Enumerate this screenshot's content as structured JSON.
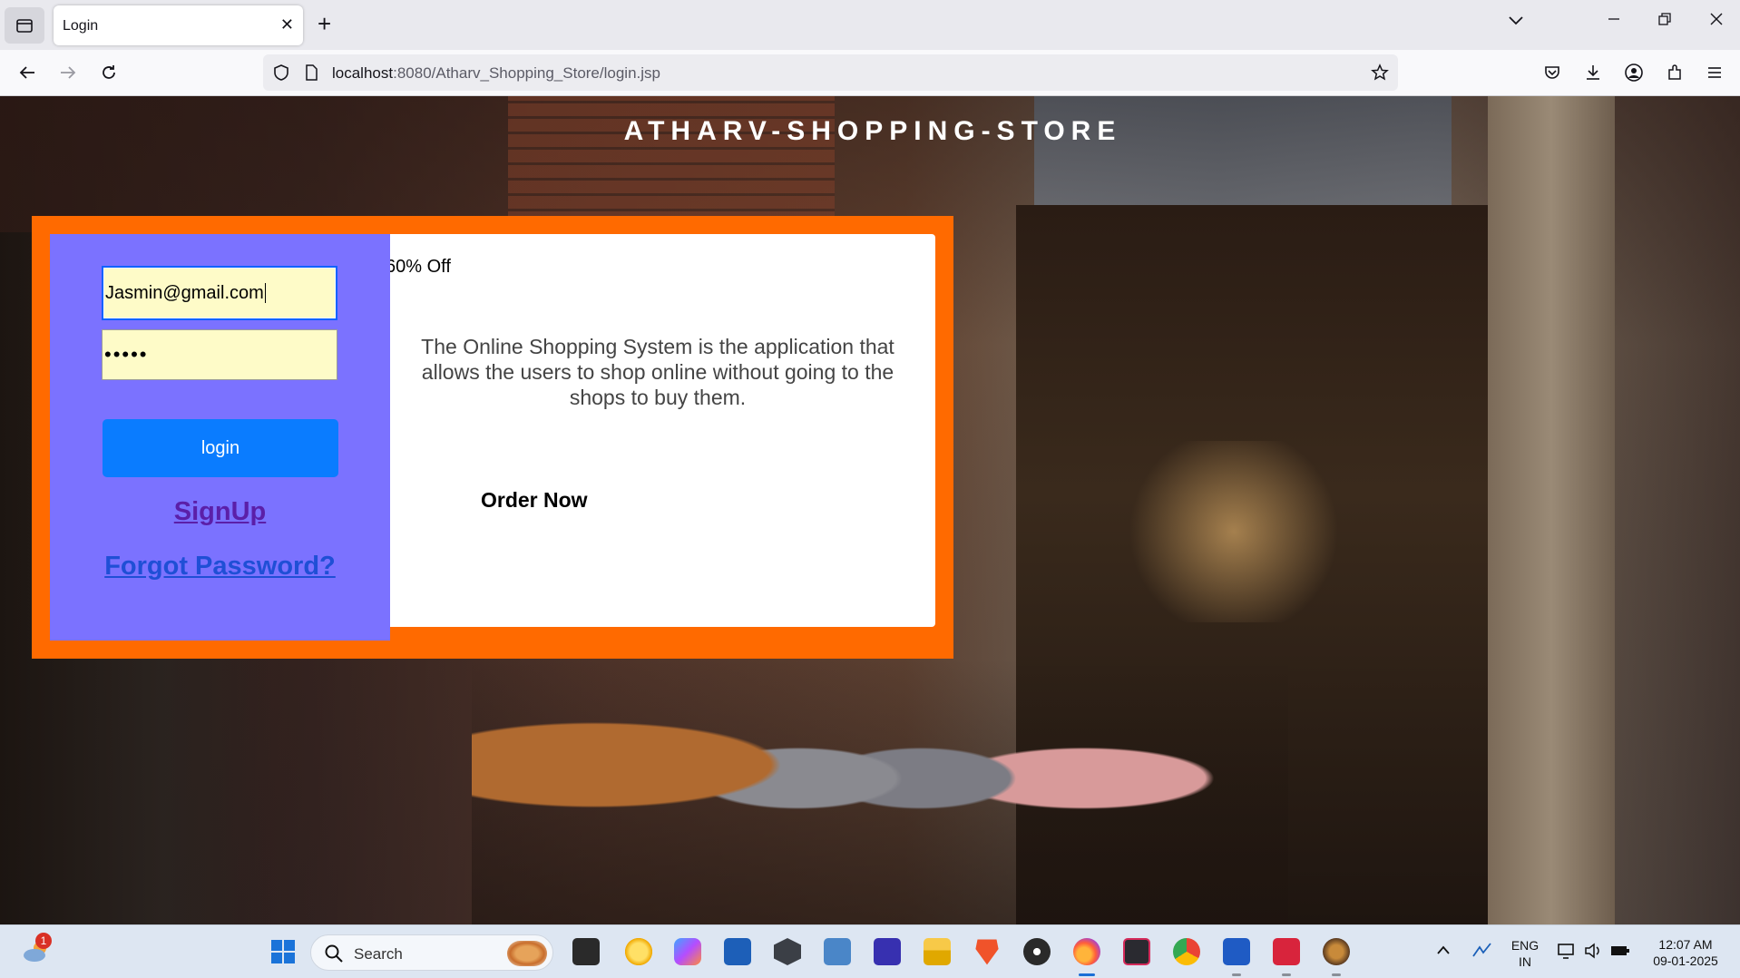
{
  "browser": {
    "tab_title": "Login",
    "tab_close": "✕",
    "new_tab": "+",
    "url_host": "localhost",
    "url_rest": ":8080/Atharv_Shopping_Store/login.jsp"
  },
  "page": {
    "site_title": "ATHARV-SHOPPING-STORE",
    "login": {
      "email_value": "Jasmin@gmail.com",
      "password_mask": "•••••",
      "login_button": "login",
      "signup_link": "SignUp",
      "forgot_link": "Forgot Password?"
    },
    "info": {
      "offer": "60% Off",
      "description": "The Online Shopping System is the application that allows the users to shop online without going to the shops to buy them.",
      "order_now": "Order Now"
    }
  },
  "taskbar": {
    "weather_badge": "1",
    "search_label": "Search",
    "language_line1": "ENG",
    "language_line2": "IN",
    "time": "12:07 AM",
    "date": "09-01-2025"
  },
  "colors": {
    "orange_frame": "#ff6a00",
    "login_panel": "#7b72ff",
    "login_button": "#0a7cff",
    "input_background": "#fefbc8"
  }
}
